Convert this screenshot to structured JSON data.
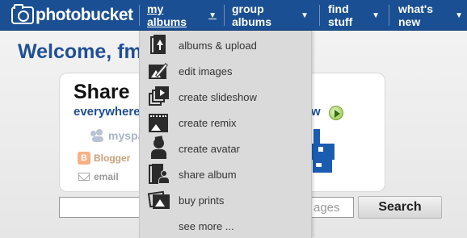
{
  "brand": {
    "name": "photobucket"
  },
  "nav": {
    "my_albums": "my albums",
    "group_albums": "group albums",
    "find_stuff": "find stuff",
    "whats_new": "what's new"
  },
  "welcome": {
    "text": "Welcome, fm"
  },
  "share": {
    "title": "Share",
    "subtitle_left": "everywhere",
    "subtitle_right": "w",
    "services": [
      "myspace",
      "Blogger",
      "email"
    ]
  },
  "search": {
    "placeholder": "ages",
    "button_label": "Search"
  },
  "menu": {
    "items": [
      {
        "label": "albums & upload",
        "icon": "albums-upload-icon"
      },
      {
        "label": "edit images",
        "icon": "edit-images-icon"
      },
      {
        "label": "create slideshow",
        "icon": "slideshow-icon"
      },
      {
        "label": "create remix",
        "icon": "remix-icon"
      },
      {
        "label": "create avatar",
        "icon": "avatar-icon"
      },
      {
        "label": "share album",
        "icon": "share-album-icon"
      },
      {
        "label": "buy prints",
        "icon": "buy-prints-icon"
      },
      {
        "label": "see more ...",
        "icon": ""
      }
    ]
  },
  "colors": {
    "nav_bar": "#1a4f93",
    "heading": "#1f4f96",
    "menu_bg": "#dadada"
  }
}
